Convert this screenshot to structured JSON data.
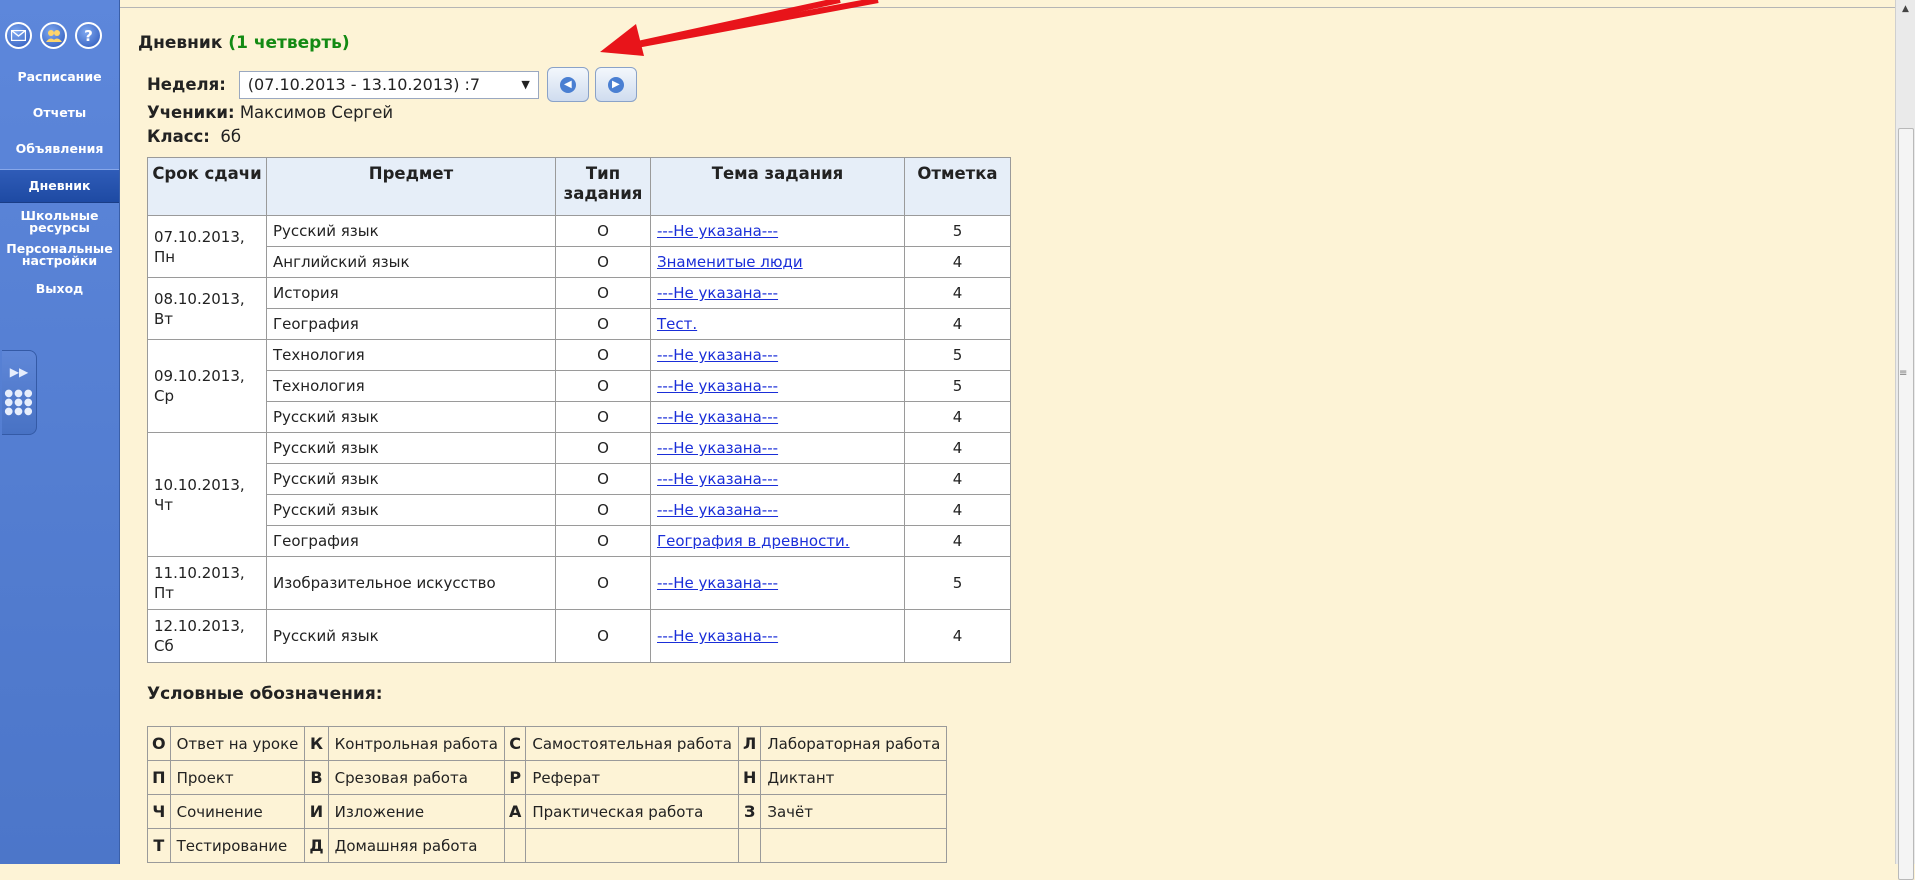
{
  "sidebar": {
    "icons": [
      "mail-icon",
      "users-icon",
      "help-icon"
    ],
    "items": [
      {
        "label": "Расписание"
      },
      {
        "label": "Отчеты"
      },
      {
        "label": "Объявления"
      },
      {
        "label": "Дневник"
      },
      {
        "label": "Школьные ресурсы"
      },
      {
        "label": "Персональные настройки"
      },
      {
        "label": "Выход"
      }
    ],
    "help_glyph": "?"
  },
  "page": {
    "title": "Дневник",
    "quarter": "(1 четверть)",
    "week_label": "Неделя:",
    "week_value": "(07.10.2013 - 13.10.2013) :7",
    "student_label": "Ученики:",
    "student_value": "Максимов Сергей",
    "class_label": "Класс:",
    "class_value": "6б"
  },
  "table": {
    "headers": [
      "Срок сдачи",
      "Предмет",
      "Тип задания",
      "Тема задания",
      "Отметка"
    ],
    "groups": [
      {
        "date": "07.10.2013,",
        "day": "Пн",
        "rows": [
          {
            "subject": "Русский язык",
            "type": "О",
            "topic": "---Не указана---",
            "mark": "5"
          },
          {
            "subject": "Английский язык",
            "type": "О",
            "topic": "Знаменитые люди",
            "mark": "4"
          }
        ]
      },
      {
        "date": "08.10.2013,",
        "day": "Вт",
        "rows": [
          {
            "subject": "История",
            "type": "О",
            "topic": "---Не указана---",
            "mark": "4"
          },
          {
            "subject": "География",
            "type": "О",
            "topic": "Тест.",
            "mark": "4"
          }
        ]
      },
      {
        "date": "09.10.2013,",
        "day": "Ср",
        "rows": [
          {
            "subject": "Технология",
            "type": "О",
            "topic": "---Не указана---",
            "mark": "5"
          },
          {
            "subject": "Технология",
            "type": "О",
            "topic": "---Не указана---",
            "mark": "5"
          },
          {
            "subject": "Русский язык",
            "type": "О",
            "topic": "---Не указана---",
            "mark": "4"
          }
        ]
      },
      {
        "date": "10.10.2013,",
        "day": "Чт",
        "rows": [
          {
            "subject": "Русский язык",
            "type": "О",
            "topic": "---Не указана---",
            "mark": "4"
          },
          {
            "subject": "Русский язык",
            "type": "О",
            "topic": "---Не указана---",
            "mark": "4"
          },
          {
            "subject": "Русский язык",
            "type": "О",
            "topic": "---Не указана---",
            "mark": "4"
          },
          {
            "subject": "География",
            "type": "О",
            "topic": "География в древности.",
            "mark": "4"
          }
        ]
      },
      {
        "date": "11.10.2013,",
        "day": "Пт",
        "tall": true,
        "rows": [
          {
            "subject": "Изобразительное искусство",
            "type": "О",
            "topic": "---Не указана---",
            "mark": "5"
          }
        ]
      },
      {
        "date": "12.10.2013,",
        "day": "Сб",
        "tall": true,
        "rows": [
          {
            "subject": "Русский язык",
            "type": "О",
            "topic": "---Не указана---",
            "mark": "4"
          }
        ]
      }
    ]
  },
  "legend": {
    "title": "Условные обозначения:",
    "rows": [
      [
        {
          "k": "О",
          "v": "Ответ на уроке"
        },
        {
          "k": "К",
          "v": "Контрольная работа"
        },
        {
          "k": "С",
          "v": "Самостоятельная работа"
        },
        {
          "k": "Л",
          "v": "Лабораторная работа"
        }
      ],
      [
        {
          "k": "П",
          "v": "Проект"
        },
        {
          "k": "В",
          "v": "Срезовая работа"
        },
        {
          "k": "Р",
          "v": "Реферат"
        },
        {
          "k": "Н",
          "v": "Диктант"
        }
      ],
      [
        {
          "k": "Ч",
          "v": "Сочинение"
        },
        {
          "k": "И",
          "v": "Изложение"
        },
        {
          "k": "А",
          "v": "Практическая работа"
        },
        {
          "k": "З",
          "v": "Зачёт"
        }
      ],
      [
        {
          "k": "Т",
          "v": "Тестирование"
        },
        {
          "k": "Д",
          "v": "Домашняя работа"
        },
        {
          "k": "",
          "v": ""
        },
        {
          "k": "",
          "v": ""
        }
      ]
    ]
  },
  "colors": {
    "background": "#fdf3d6",
    "sidebar": "#5578cf",
    "quarter_text": "#138a13",
    "link": "#1a2ed8",
    "annotation_arrow": "#e8141a"
  }
}
